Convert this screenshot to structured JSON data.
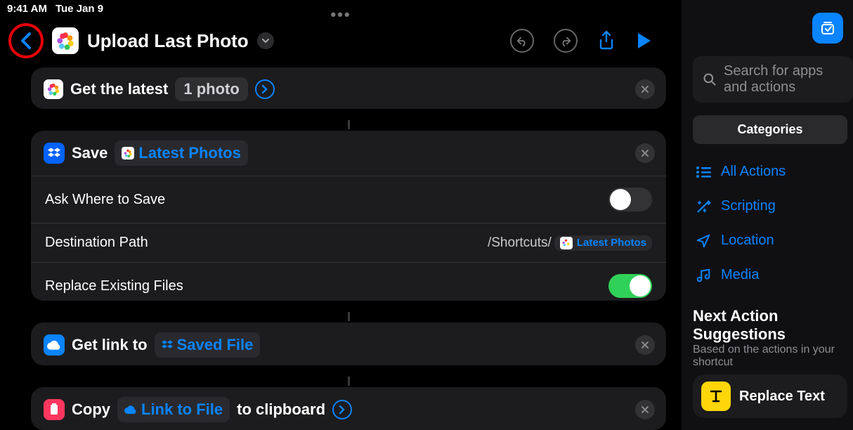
{
  "status": {
    "time": "9:41 AM",
    "date": "Tue Jan 9",
    "overflow": "•••"
  },
  "header": {
    "title": "Upload Last Photo"
  },
  "actions": {
    "a1": {
      "prefix": "Get the latest",
      "param": "1 photo"
    },
    "a2": {
      "verb": "Save",
      "input": "Latest Photos",
      "rows": {
        "ask": {
          "label": "Ask Where to Save",
          "value": false
        },
        "dest": {
          "label": "Destination Path",
          "prefix": "/Shortcuts/",
          "token": "Latest Photos"
        },
        "replace": {
          "label": "Replace Existing Files",
          "value": true
        }
      }
    },
    "a3": {
      "prefix": "Get link to",
      "token": "Saved File"
    },
    "a4": {
      "verb": "Copy",
      "token": "Link to File",
      "suffix": "to clipboard"
    }
  },
  "sidebar": {
    "search_placeholder": "Search for apps and actions",
    "segment": "Categories",
    "categories": {
      "all": "All Actions",
      "scripting": "Scripting",
      "location": "Location",
      "media": "Media"
    },
    "suggestions": {
      "title": "Next Action Suggestions",
      "subtitle": "Based on the actions in your shortcut",
      "item1": "Replace Text"
    }
  }
}
